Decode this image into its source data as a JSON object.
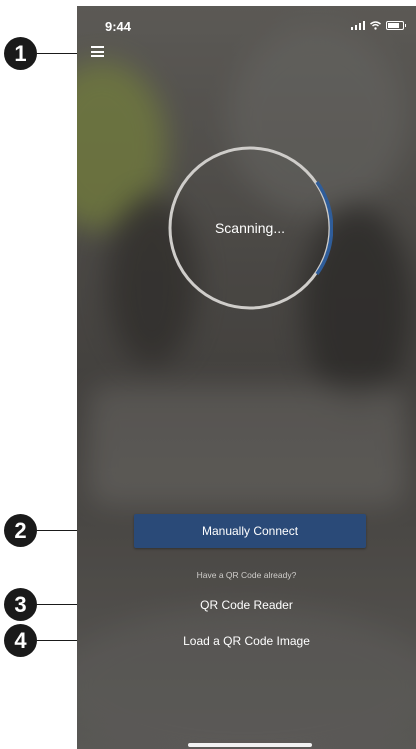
{
  "status_bar": {
    "time": "9:44"
  },
  "scanner": {
    "status_text": "Scanning...",
    "progress_color": "#2f5d9a"
  },
  "actions": {
    "manual_connect_label": "Manually Connect",
    "qr_hint": "Have a QR Code already?",
    "qr_reader_label": "QR Code Reader",
    "load_qr_image_label": "Load a QR Code Image"
  },
  "callouts": [
    "1",
    "2",
    "3",
    "4"
  ],
  "colors": {
    "primary_button": "#2a4a78",
    "callout": "#1a1a1a"
  },
  "icons": {
    "menu": "hamburger-menu-icon",
    "signal": "signal-icon",
    "wifi": "wifi-icon",
    "battery": "battery-icon"
  }
}
